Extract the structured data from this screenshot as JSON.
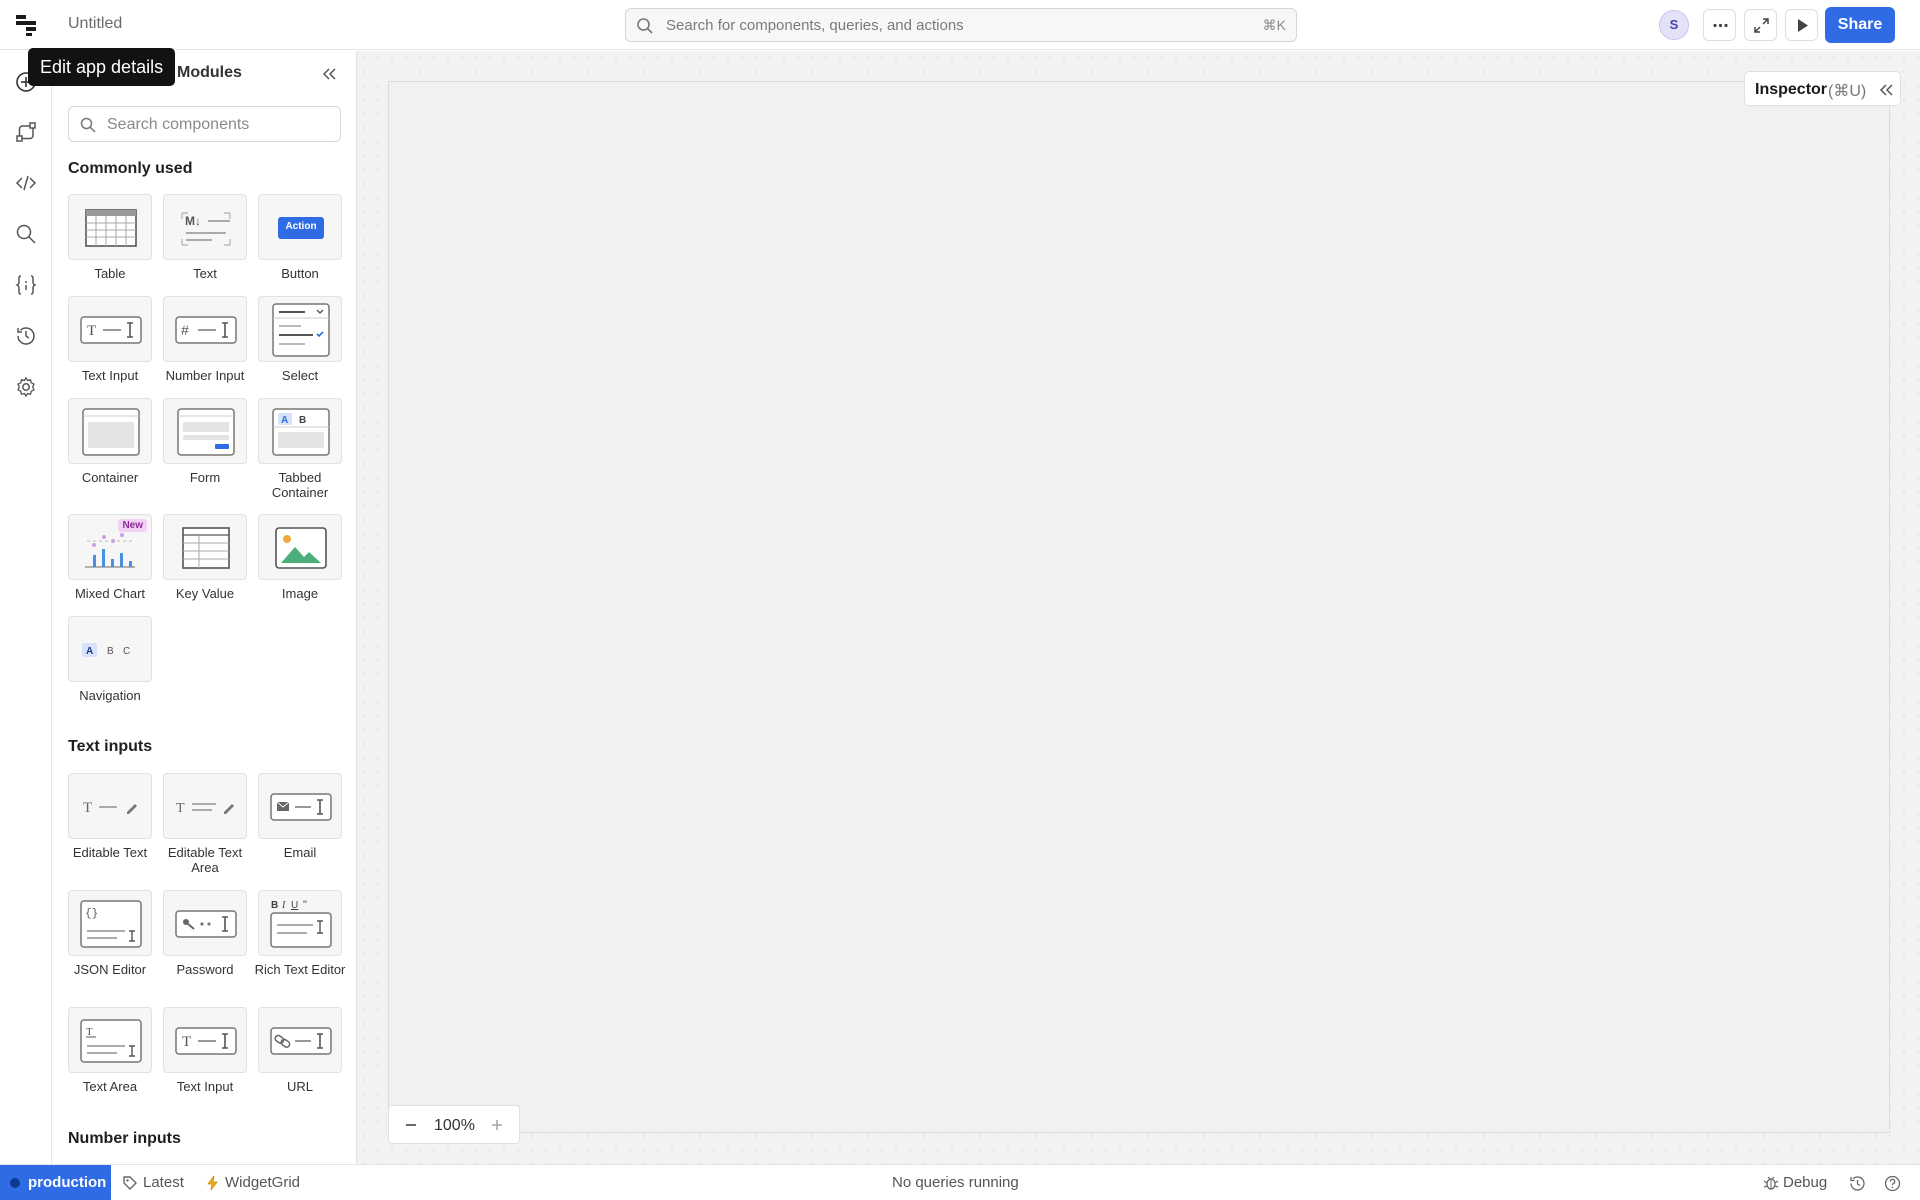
{
  "app": {
    "title": "Untitled",
    "logo_icon": "retool-logo-icon"
  },
  "search": {
    "placeholder": "Search for components, queries, and actions",
    "shortcut": "⌘K"
  },
  "header": {
    "avatar_initial": "S",
    "share_label": "Share",
    "more_icon": "ellipsis-icon",
    "expand_icon": "expand-icon",
    "preview_icon": "play-icon"
  },
  "tooltip": {
    "text": "Edit app details"
  },
  "rail": {
    "items": [
      "add-icon",
      "workflow-icon",
      "code-icon",
      "search-icon",
      "state-icon",
      "history-icon",
      "settings-icon"
    ],
    "ai_icon": "sparkle-icon"
  },
  "panel": {
    "tab": "Modules",
    "search_placeholder": "Search components",
    "sections": [
      {
        "title": "Commonly used",
        "items": [
          "Table",
          "Text",
          "Button",
          "Text Input",
          "Number Input",
          "Select",
          "Container",
          "Form",
          "Tabbed Container",
          "Mixed Chart",
          "Key Value",
          "Image",
          "Navigation"
        ]
      },
      {
        "title": "Text inputs",
        "items": [
          "Editable Text",
          "Editable Text Area",
          "Email",
          "JSON Editor",
          "Password",
          "Rich Text Editor",
          "Text Area",
          "Text Input",
          "URL"
        ]
      },
      {
        "title": "Number inputs",
        "items": []
      }
    ],
    "new_badge": "New",
    "button_preview_label": "Action"
  },
  "inspector": {
    "label": "Inspector",
    "shortcut": "(⌘U)"
  },
  "zoom": {
    "value": "100%"
  },
  "status": {
    "environment": "production",
    "version": "Latest",
    "widget": "WidgetGrid",
    "queries": "No queries running",
    "debug": "Debug"
  },
  "colors": {
    "accent": "#2f6be4",
    "ai_bg": "#fbe7f3",
    "new_badge": "#f3d1f4"
  }
}
